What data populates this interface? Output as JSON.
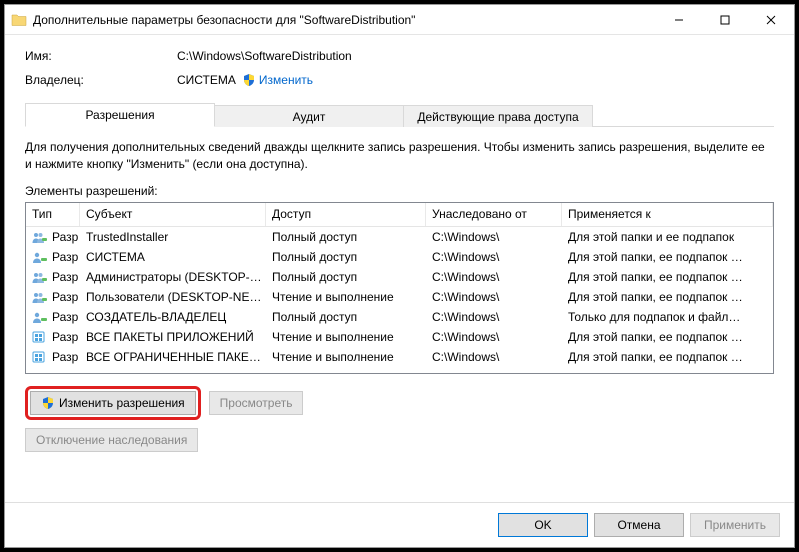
{
  "window": {
    "title": "Дополнительные параметры безопасности  для \"SoftwareDistribution\""
  },
  "info": {
    "name_label": "Имя:",
    "name_value": "C:\\Windows\\SoftwareDistribution",
    "owner_label": "Владелец:",
    "owner_value": "СИСТЕМА",
    "change_link": "Изменить"
  },
  "tabs": {
    "permissions": "Разрешения",
    "audit": "Аудит",
    "effective": "Действующие права доступа"
  },
  "description": "Для получения дополнительных сведений дважды щелкните запись разрешения. Чтобы изменить запись разрешения, выделите ее и нажмите кнопку \"Изменить\" (если она доступна).",
  "section_label": "Элементы разрешений:",
  "columns": {
    "type": "Тип",
    "subject": "Субъект",
    "access": "Доступ",
    "inherit": "Унаследовано от",
    "applies": "Применяется к"
  },
  "rows": [
    {
      "icon": "group",
      "type": "Разр…",
      "subject": "TrustedInstaller",
      "access": "Полный доступ",
      "inherit": "C:\\Windows\\",
      "applies": "Для этой папки и ее подпапок"
    },
    {
      "icon": "user",
      "type": "Разр…",
      "subject": "СИСТЕМА",
      "access": "Полный доступ",
      "inherit": "C:\\Windows\\",
      "applies": "Для этой папки, ее подпапок …"
    },
    {
      "icon": "group",
      "type": "Разр…",
      "subject": "Администраторы (DESKTOP-…",
      "access": "Полный доступ",
      "inherit": "C:\\Windows\\",
      "applies": "Для этой папки, ее подпапок …"
    },
    {
      "icon": "group",
      "type": "Разр…",
      "subject": "Пользователи (DESKTOP-NE…",
      "access": "Чтение и выполнение",
      "inherit": "C:\\Windows\\",
      "applies": "Для этой папки, ее подпапок …"
    },
    {
      "icon": "user",
      "type": "Разр…",
      "subject": "СОЗДАТЕЛЬ-ВЛАДЕЛЕЦ",
      "access": "Полный доступ",
      "inherit": "C:\\Windows\\",
      "applies": "Только для подпапок и файл…"
    },
    {
      "icon": "pkg",
      "type": "Разр…",
      "subject": "ВСЕ ПАКЕТЫ ПРИЛОЖЕНИЙ",
      "access": "Чтение и выполнение",
      "inherit": "C:\\Windows\\",
      "applies": "Для этой папки, ее подпапок …"
    },
    {
      "icon": "pkg",
      "type": "Разр…",
      "subject": "ВСЕ ОГРАНИЧЕННЫЕ ПАКЕТ…",
      "access": "Чтение и выполнение",
      "inherit": "C:\\Windows\\",
      "applies": "Для этой папки, ее подпапок …"
    }
  ],
  "buttons": {
    "change_perm": "Изменить разрешения",
    "view": "Просмотреть",
    "disable_inherit": "Отключение наследования",
    "ok": "OK",
    "cancel": "Отмена",
    "apply": "Применить"
  }
}
